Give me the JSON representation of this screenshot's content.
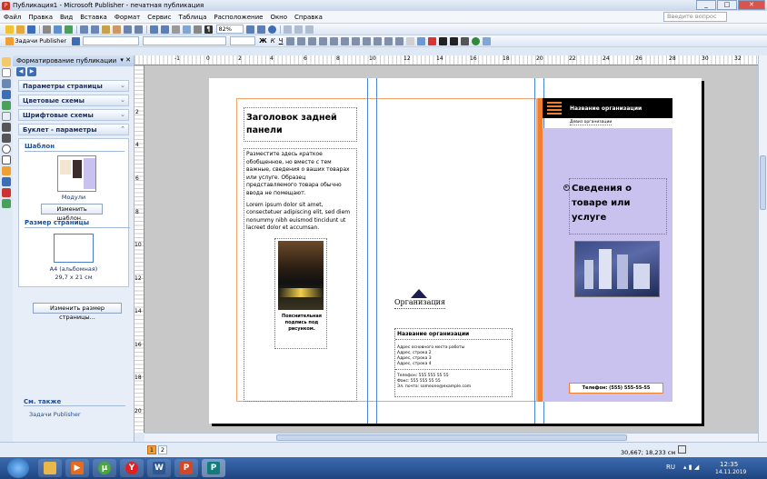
{
  "window": {
    "title": "Публикация1 - Microsoft Publisher - печатная публикация"
  },
  "menu": {
    "items": [
      "Файл",
      "Правка",
      "Вид",
      "Вставка",
      "Формат",
      "Сервис",
      "Таблица",
      "Расположение",
      "Окно",
      "Справка"
    ],
    "help_placeholder": "Введите вопрос"
  },
  "toolbar": {
    "zoom": "82%",
    "tasks_label": "Задачи Publisher"
  },
  "task_pane": {
    "title": "Форматирование публикации",
    "sections": [
      "Параметры страницы",
      "Цветовые схемы",
      "Шрифтовые схемы",
      "Буклет - параметры"
    ],
    "template_header": "Шаблон",
    "template_name": "Модули",
    "change_template_button": "Изменить шаблон...",
    "page_size_header": "Размер страницы",
    "page_size_name": "А4 (альбомная)",
    "page_size_dims": "29,7 x 21 см",
    "change_size_button": "Изменить размер страницы...",
    "see_also_header": "См. также",
    "see_also_link": "Задачи Publisher"
  },
  "ruler": {
    "ticks": [
      "-1",
      "0",
      "2",
      "4",
      "6",
      "8",
      "10",
      "12",
      "14",
      "16",
      "18",
      "20",
      "22",
      "24",
      "26",
      "28",
      "30",
      "32"
    ],
    "vticks": [
      "2",
      "4",
      "6",
      "8",
      "10",
      "12",
      "14",
      "16",
      "18",
      "20"
    ]
  },
  "publication": {
    "left_panel": {
      "heading": "Заголовок задней панели",
      "body1": "Разместите здесь краткое обобщенное, но вместе с тем важные, сведения о ваших товарах или услуге. Образец представляемого товара обычно ввода не помещают.",
      "body2": "Lorem ipsum dolor sit amet, consectetuer adipiscing elit, sed diem nonummy nibh euismod tincidunt ut lacreet dolor et accumsan.",
      "caption": "Пояснительная подпись под рисунком."
    },
    "middle_panel": {
      "logo_text": "Организация",
      "org_name": "Название организации",
      "address_lines": [
        "Адрес основного места работы",
        "Адрес, строка 2",
        "Адрес, строка 3",
        "Адрес, строка 4"
      ],
      "phone": "Телефон: 555 555 55 55",
      "fax": "Факс: 555 555 55 55",
      "email": "Эл. почта: someone@example.com"
    },
    "right_panel": {
      "org_name": "Название организации",
      "tagline": "Девиз организации",
      "headline": "Сведения о товаре или услуге",
      "phone": "Телефон: (555) 555-55-55"
    }
  },
  "statusbar": {
    "page1": "1",
    "page2": "2",
    "position": "30,667; 18,233 см"
  },
  "taskbar": {
    "lang": "RU",
    "time": "12:35",
    "date": "14.11.2019"
  },
  "colors": {
    "accent": "#3d6db5",
    "panel_lilac": "#c9c2ee",
    "orange": "#f08030",
    "title_bg": "#000000"
  }
}
